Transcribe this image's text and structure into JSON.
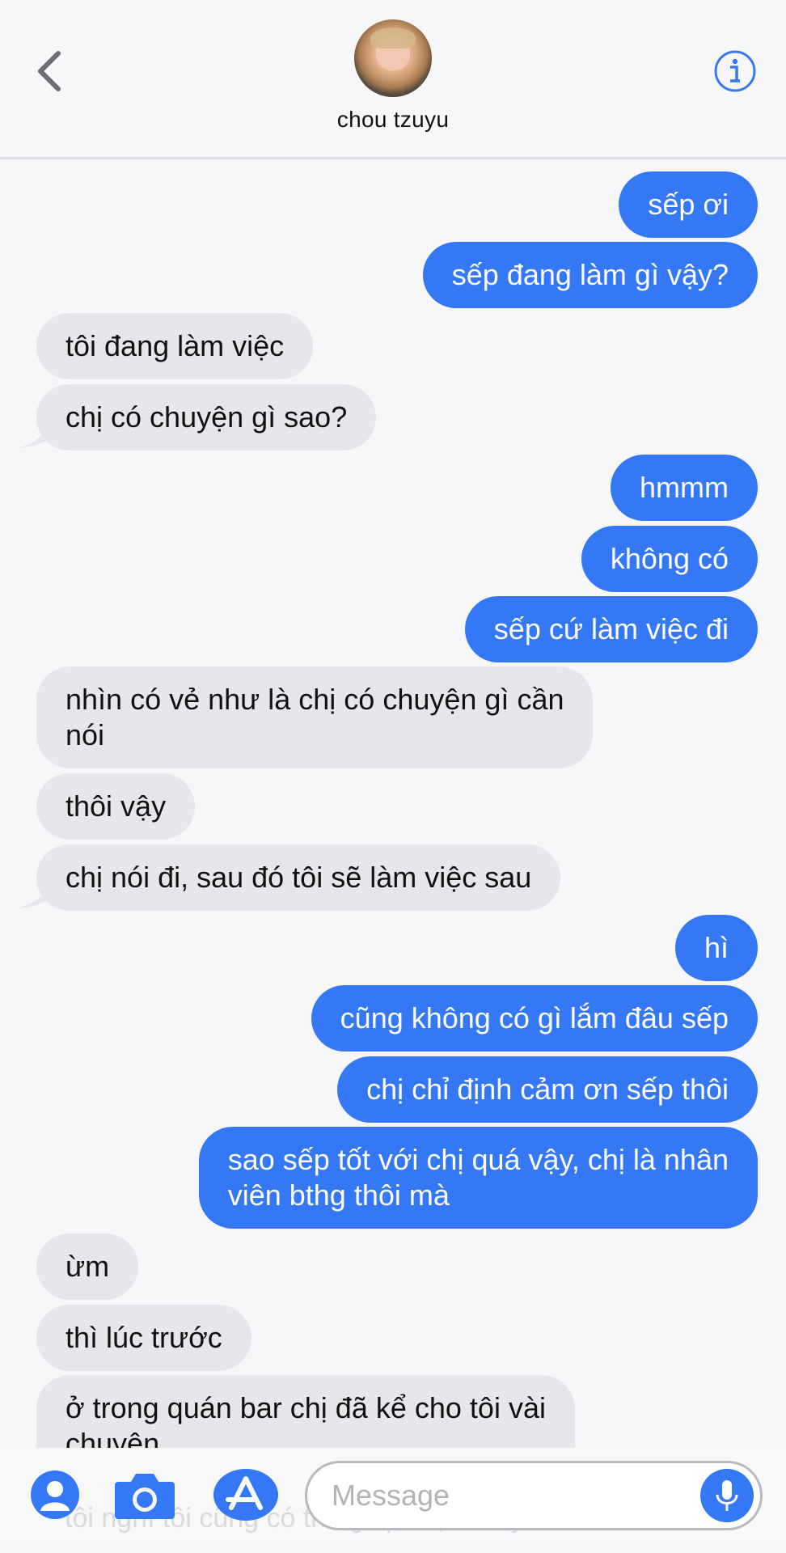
{
  "contact": {
    "name": "chou tzuyu"
  },
  "messages": [
    {
      "dir": "out",
      "text": "sếp ơi"
    },
    {
      "dir": "out",
      "text": "sếp đang làm gì vậy?"
    },
    {
      "dir": "in",
      "text": "tôi đang làm việc"
    },
    {
      "dir": "in",
      "text": "chị có chuyện gì sao?"
    },
    {
      "dir": "out",
      "text": "hmmm"
    },
    {
      "dir": "out",
      "text": "không có"
    },
    {
      "dir": "out",
      "text": "sếp cứ làm việc đi"
    },
    {
      "dir": "in",
      "text": "nhìn có vẻ như là chị có chuyện gì cần\nnói"
    },
    {
      "dir": "in",
      "text": "thôi vậy"
    },
    {
      "dir": "in",
      "text": "chị nói đi, sau đó tôi sẽ làm việc sau"
    },
    {
      "dir": "out",
      "text": "hì"
    },
    {
      "dir": "out",
      "text": "cũng không có gì lắm đâu sếp"
    },
    {
      "dir": "out",
      "text": "chị chỉ định cảm ơn sếp thôi"
    },
    {
      "dir": "out",
      "text": "sao sếp tốt với chị quá vậy, chị là nhân\nviên bthg thôi mà"
    },
    {
      "dir": "in",
      "text": "ừm"
    },
    {
      "dir": "in",
      "text": "thì lúc trước"
    },
    {
      "dir": "in",
      "text": "ở trong quán bar chị đã kể cho tôi vài\nchuyện"
    },
    {
      "dir": "in",
      "text": "tôi nghĩ tôi cũng có thể giúp chị\nkhuây khỏa hơn"
    }
  ],
  "composer": {
    "placeholder": "Message"
  },
  "colors": {
    "outgoing": "#3478f6",
    "incoming": "#e6e6eb",
    "accent": "#3478f6"
  },
  "icons": [
    "back-chevron-icon",
    "info-icon",
    "contact-icon",
    "camera-icon",
    "app-store-icon",
    "microphone-icon"
  ]
}
